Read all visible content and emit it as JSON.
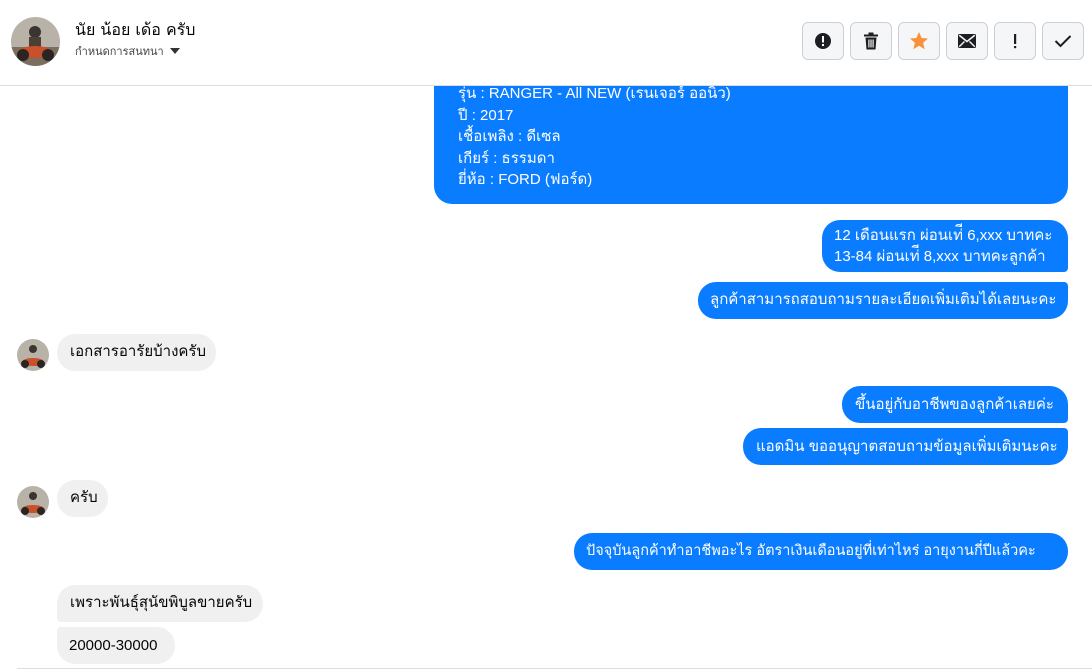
{
  "header": {
    "name": "นัย น้อย เด้อ ครับ",
    "subtitle": "กำหนดการสนทนา",
    "actions": [
      {
        "name": "alert-icon",
        "label": "Mark as spam"
      },
      {
        "name": "trash-icon",
        "label": "Delete"
      },
      {
        "name": "star-icon",
        "label": "Star",
        "color": "#f7923a"
      },
      {
        "name": "envelope-icon",
        "label": "Mark as unread"
      },
      {
        "name": "exclamation-icon",
        "label": "Follow up"
      },
      {
        "name": "checkmark-icon",
        "label": "Done"
      }
    ]
  },
  "colors": {
    "outgoing_bubble": "#0a7cff",
    "incoming_bubble": "#f0f0f0",
    "star": "#f7923a"
  },
  "messages": {
    "m1": {
      "direction": "outgoing",
      "lines": [
        "รุ่น : RANGER - All NEW (เรนเจอร์ ออนิว)",
        "ปี : 2017",
        "เชื้อเพลิง : ดีเซล",
        "เกียร์ : ธรรมดา",
        "ยี่ห้อ : FORD (ฟอร์ด)"
      ]
    },
    "m2": {
      "direction": "outgoing",
      "lines": [
        "12 เดือนแรก ผ่อนเท่ี 6,xxx บาทคะ",
        "13-84 ผ่อนเท่ี 8,xxx บาทคะลูกค้า"
      ]
    },
    "m3": {
      "direction": "outgoing",
      "text": "ลูกค้าสามารถสอบถามรายละเอียดเพิ่มเติมได้เลยนะคะ"
    },
    "m4": {
      "direction": "incoming",
      "text": "เอกสารอารัยบ้างครับ"
    },
    "m5": {
      "direction": "outgoing",
      "text": "ขึ้นอยู่กับอาชีพของลูกค้าเลยค่ะ"
    },
    "m6": {
      "direction": "outgoing",
      "text": "แอดมิน ขออนุญาตสอบถามข้อมูลเพิ่มเติมนะคะ"
    },
    "m7": {
      "direction": "incoming",
      "text": "ครับ"
    },
    "m8": {
      "direction": "outgoing",
      "text": "ปัจจุบันลูกค้าทำอาชีพอะไร อัตราเงินเดือนอยู่ที่เท่าไหร่ อายุงานกี่ปีแล้วคะ"
    },
    "m9": {
      "direction": "incoming",
      "text": "เพราะพันธุ์สุนัขพิบูลขายครับ"
    },
    "m10": {
      "direction": "incoming",
      "text": "20000-30000"
    }
  }
}
